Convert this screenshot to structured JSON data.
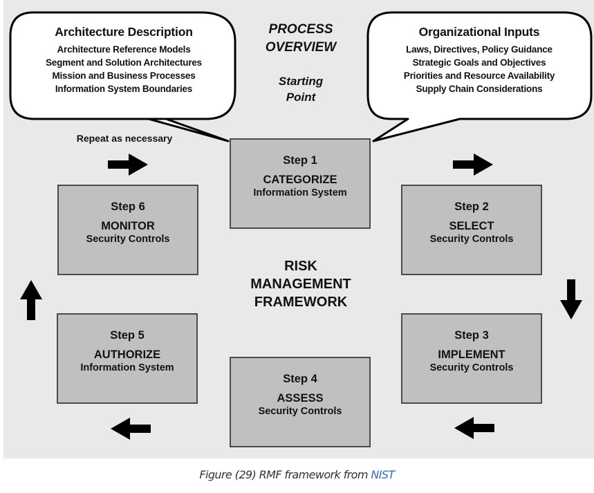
{
  "diagram": {
    "header": {
      "process_overview": [
        "PROCESS",
        "OVERVIEW"
      ],
      "starting_point": [
        "Starting",
        "Point"
      ]
    },
    "left_bubble": {
      "title": "Architecture Description",
      "lines": [
        "Architecture Reference Models",
        "Segment and Solution Architectures",
        "Mission and Business Processes",
        "Information System Boundaries"
      ]
    },
    "right_bubble": {
      "title": "Organizational Inputs",
      "lines": [
        "Laws, Directives, Policy Guidance",
        "Strategic Goals and Objectives",
        "Priorities and Resource Availability",
        "Supply Chain Considerations"
      ]
    },
    "repeat_label": "Repeat as necessary",
    "center_title": [
      "RISK",
      "MANAGEMENT",
      "FRAMEWORK"
    ],
    "steps": [
      {
        "num": "Step 1",
        "name": "CATEGORIZE",
        "sub": "Information System"
      },
      {
        "num": "Step 2",
        "name": "SELECT",
        "sub": "Security Controls"
      },
      {
        "num": "Step 3",
        "name": "IMPLEMENT",
        "sub": "Security Controls"
      },
      {
        "num": "Step 4",
        "name": "ASSESS",
        "sub": "Security Controls"
      },
      {
        "num": "Step 5",
        "name": "AUTHORIZE",
        "sub": "Information System"
      },
      {
        "num": "Step 6",
        "name": "MONITOR",
        "sub": "Security Controls"
      }
    ],
    "arrows": [
      "arrow-right",
      "arrow-right",
      "arrow-down",
      "arrow-left",
      "arrow-left",
      "arrow-up"
    ],
    "colors": {
      "background": "#e9e9e9",
      "step_fill": "#c0c0c0",
      "bubble_fill": "#ffffff"
    }
  },
  "caption": {
    "text": "Figure (29) RMF framework from ",
    "link": "NIST",
    "link_color": "#2f6fb5"
  }
}
